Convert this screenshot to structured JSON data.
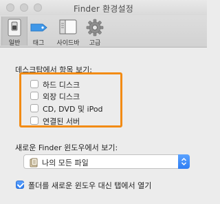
{
  "window": {
    "title": "Finder 환경설정"
  },
  "toolbar": {
    "tabs": [
      {
        "label": "일반",
        "icon": "switch-icon"
      },
      {
        "label": "태그",
        "icon": "tag-icon"
      },
      {
        "label": "사이드바",
        "icon": "sidebar-icon"
      },
      {
        "label": "고급",
        "icon": "gear-icon"
      }
    ],
    "selected": "일반"
  },
  "desktop_section": {
    "heading": "데스크탑에서 항목 보기:",
    "items": [
      {
        "label": "하드 디스크",
        "checked": false
      },
      {
        "label": "외장 디스크",
        "checked": false
      },
      {
        "label": "CD, DVD 및 iPod",
        "checked": false
      },
      {
        "label": "연결된 서버",
        "checked": false
      }
    ]
  },
  "new_window_section": {
    "heading": "새로운 Finder 윈도우에서 보기:",
    "selected_value": "나의 모든 파일"
  },
  "open_folders": {
    "label": "폴더를 새로운 윈도우 대신 탭에서 열기",
    "checked": true
  },
  "colors": {
    "accent": "#2f7ef3",
    "highlight": "#f28b14",
    "background": "#ececec"
  }
}
